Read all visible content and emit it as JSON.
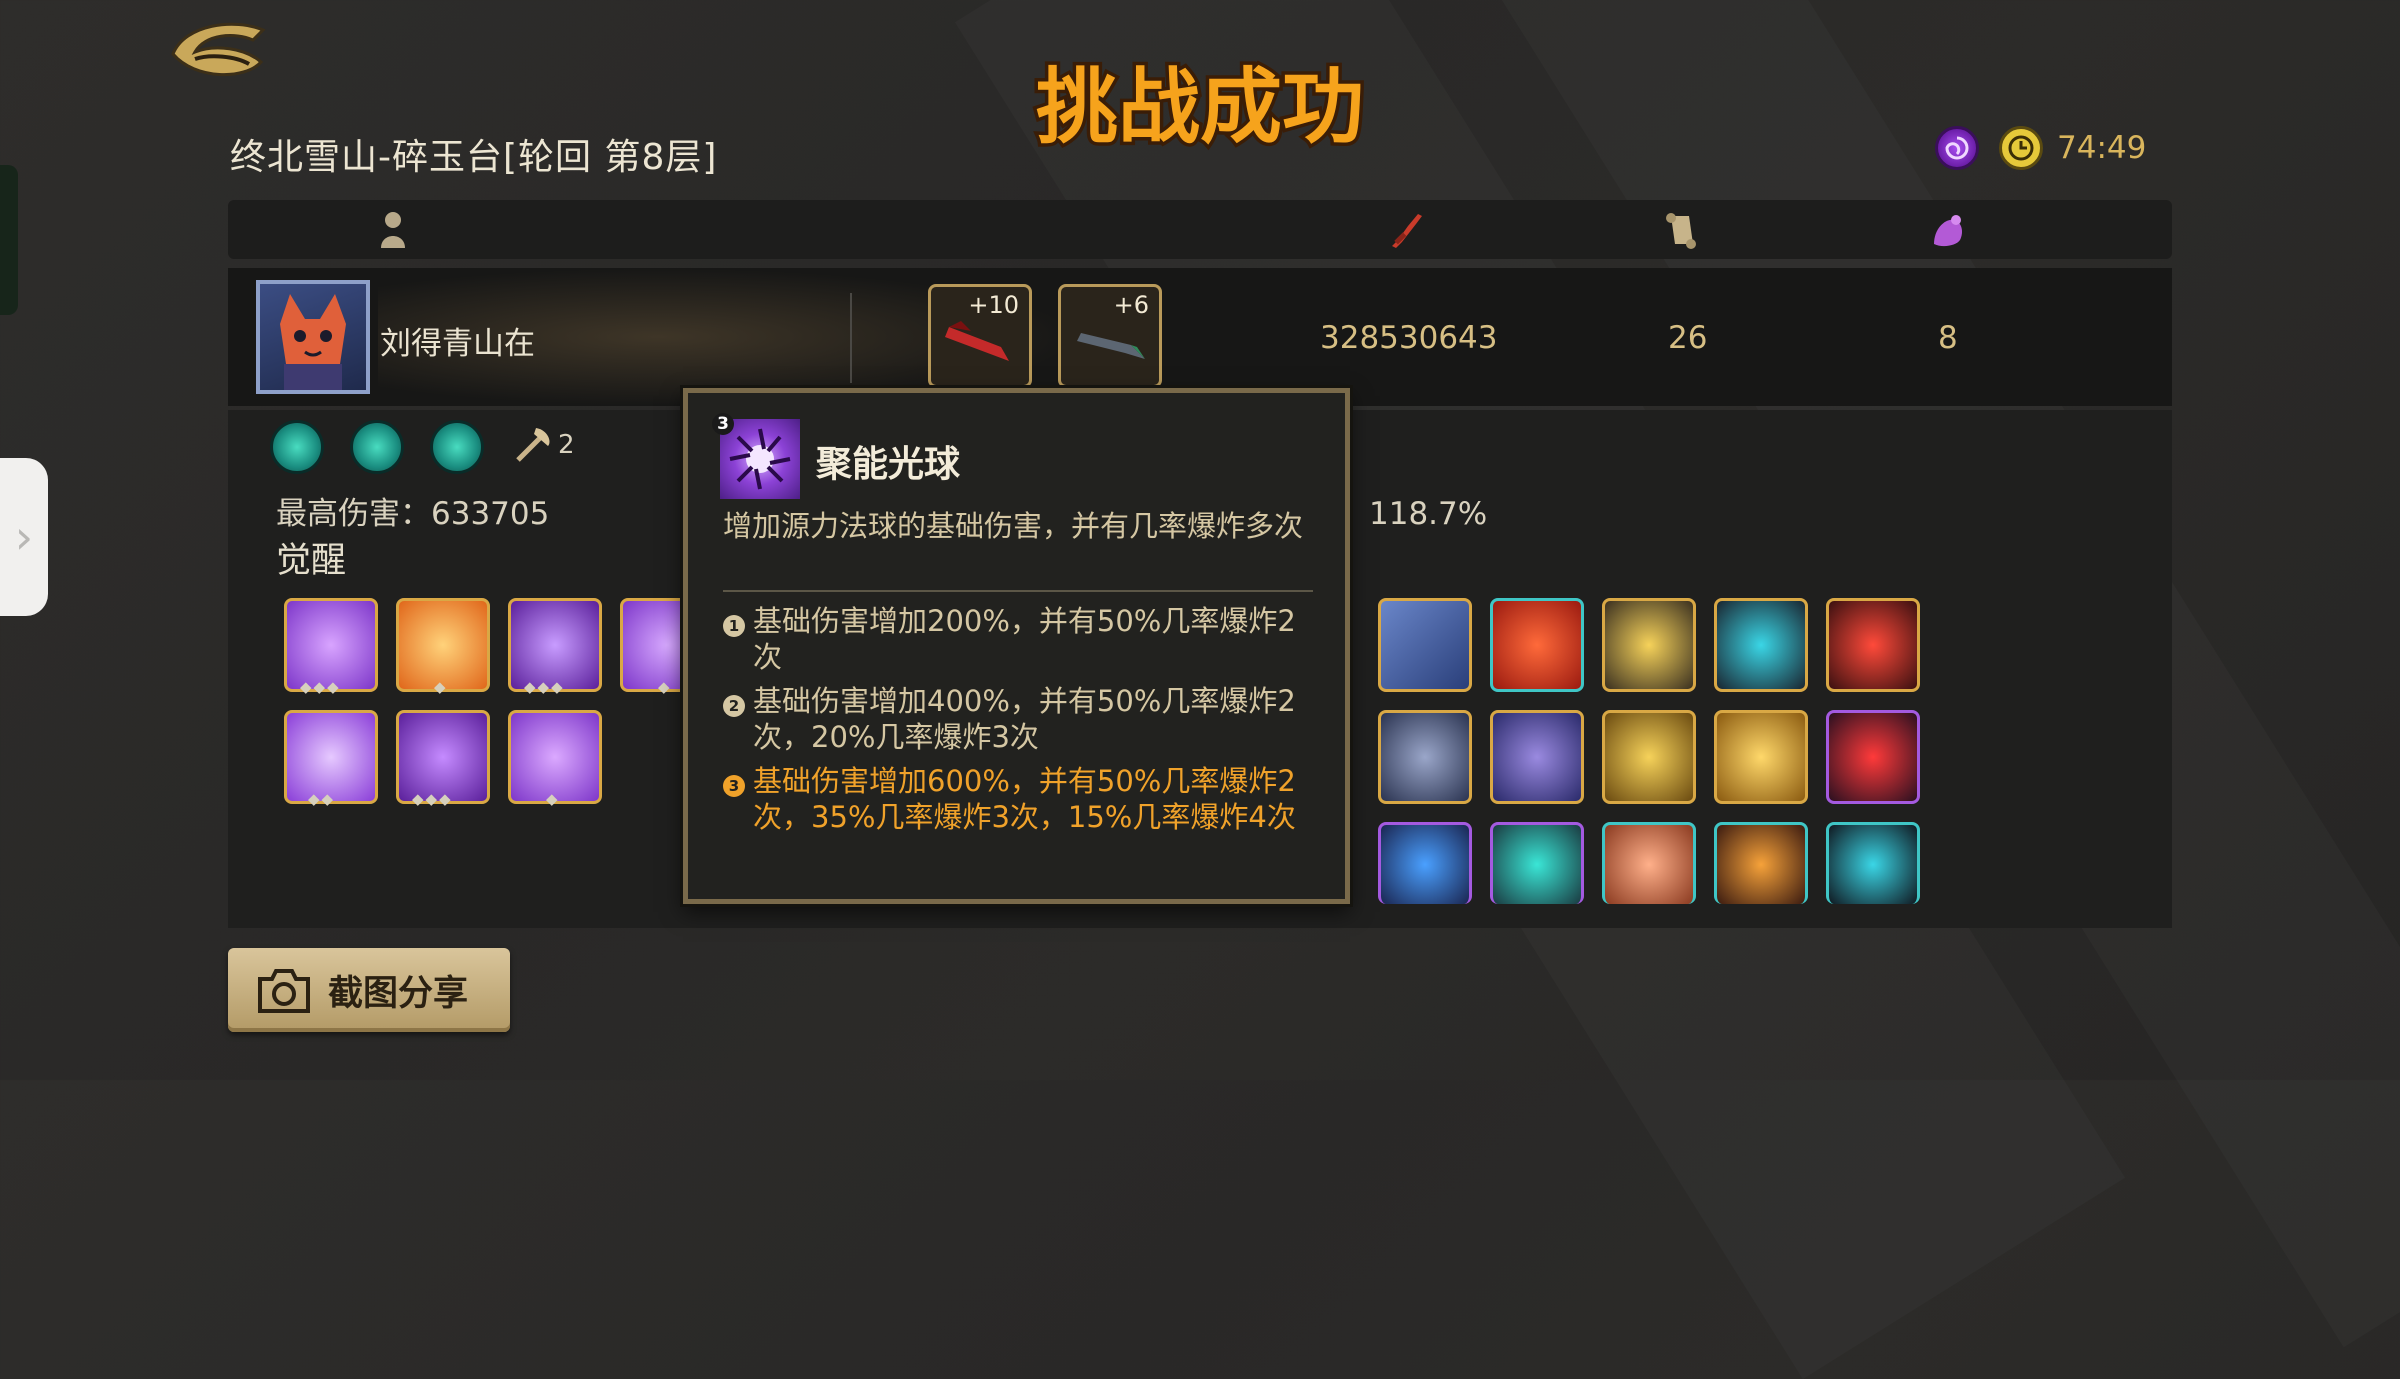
{
  "header": {
    "title_banner": "挑战成功",
    "location": "终北雪山-碎玉台[轮回 第8层]",
    "timer": "74:49"
  },
  "player": {
    "name": "刘得青山在",
    "weapons": [
      {
        "level": "+10",
        "icon": "red-blade-icon"
      },
      {
        "level": "+6",
        "icon": "dark-sword-icon"
      }
    ],
    "damage": "328530643",
    "stat2": "26",
    "stat3": "8"
  },
  "detail": {
    "skill_extra_count": "2",
    "max_damage": "最高伤害：633705",
    "awaken_label": "觉醒",
    "hidden_stat": "：118.7%"
  },
  "tooltip": {
    "badge": "3",
    "title": "聚能光球",
    "description": "增加源力法球的基础伤害，并有几率爆炸多次",
    "levels": [
      {
        "num": "1",
        "text": "基础伤害增加200%，并有50%几率爆炸2次"
      },
      {
        "num": "2",
        "text": "基础伤害增加400%，并有50%几率爆炸2次，20%几率爆炸3次"
      },
      {
        "num": "3",
        "text": "基础伤害增加600%，并有50%几率爆炸2次，35%几率爆炸3次，15%几率爆炸4次"
      }
    ]
  },
  "share_button": "截图分享",
  "colors": {
    "accent_gold": "#d9b55c",
    "highlight_orange": "#f0a22a",
    "purple_rarity": "#a45ae0",
    "cyan_rarity": "#3fc6c6",
    "gold_rarity": "#d9a845"
  }
}
